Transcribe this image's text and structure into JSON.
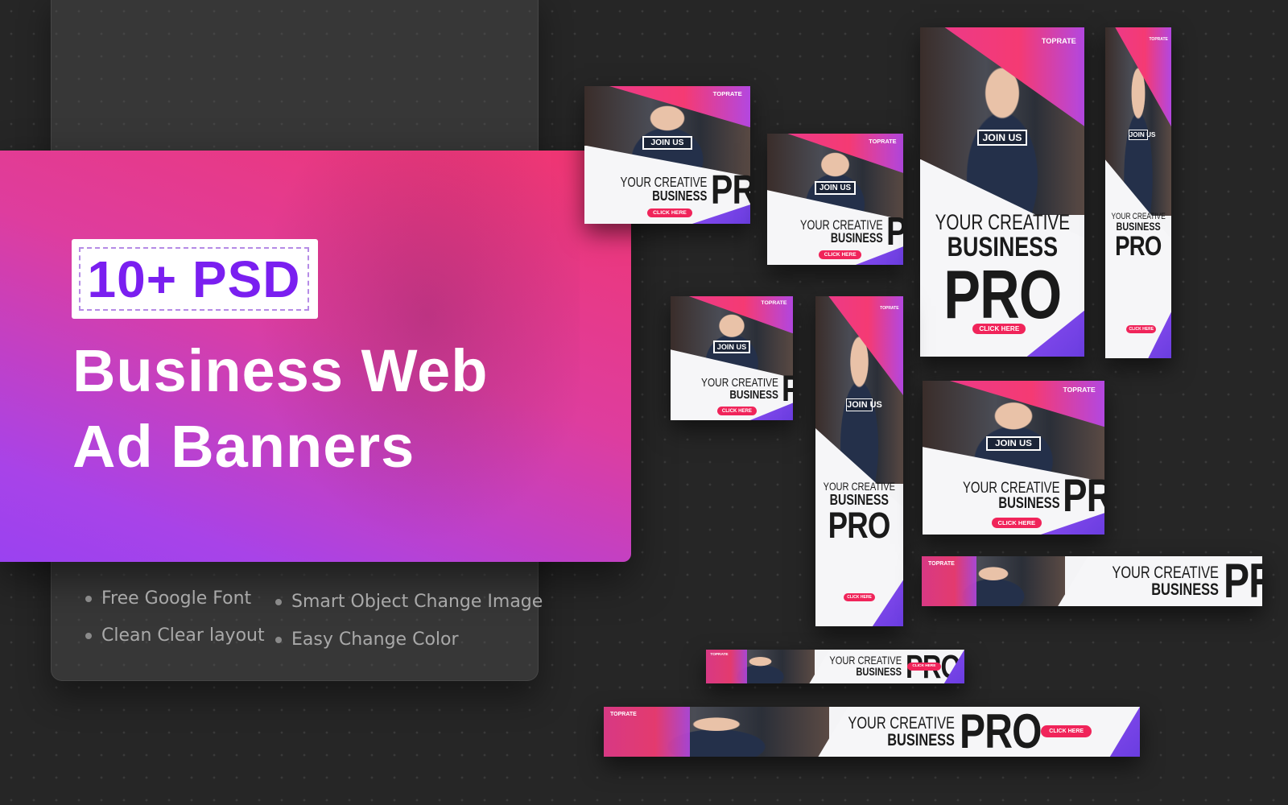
{
  "hero": {
    "badge": "10+ PSD",
    "title_line1": "Business Web",
    "title_line2": "Ad Banners",
    "gradient": [
      "#f1356f",
      "#9a42f0"
    ],
    "badge_color": "#7a1ff0"
  },
  "features": [
    {
      "label": "Free Google Font"
    },
    {
      "label": "Smart Object Change Image"
    },
    {
      "label": "Clean Clear layout"
    },
    {
      "label": "Easy Change Color"
    }
  ],
  "banner": {
    "brand": "TOPRATE",
    "join": "JOIN US",
    "tagline1": "YOUR CREATIVE",
    "tagline2": "BUSINESS",
    "headline": "PRO",
    "cta": "CLICK HERE",
    "cta_color": "#f0245a"
  },
  "banners": [
    {
      "orientation": "landscape-box",
      "join": true,
      "cta": true
    },
    {
      "orientation": "landscape-box",
      "join": true,
      "cta": true
    },
    {
      "orientation": "tall",
      "join": true,
      "cta": true
    },
    {
      "orientation": "skyscraper",
      "join": true,
      "cta": true
    },
    {
      "orientation": "square",
      "join": true,
      "cta": true
    },
    {
      "orientation": "skyscraper",
      "join": true,
      "cta": true
    },
    {
      "orientation": "landscape-box",
      "join": true,
      "cta": true
    },
    {
      "orientation": "leaderboard",
      "join": false,
      "cta": false
    },
    {
      "orientation": "leaderboard",
      "join": false,
      "cta": true
    },
    {
      "orientation": "leaderboard",
      "join": false,
      "cta": true
    }
  ]
}
